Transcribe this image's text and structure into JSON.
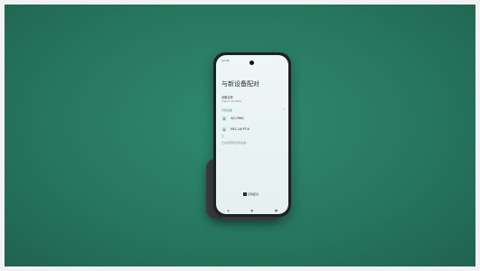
{
  "screen": {
    "title": "与新设备配对",
    "device_name_label": "设备名称",
    "device_name_value": "Xiaomi 14 Ultra",
    "available_label": "可用设备",
    "devices": [
      {
        "name": "XJQ-P86C"
      },
      {
        "name": "MEC-LW-PT-N"
      }
    ],
    "hint": "正在搜索附近的设备…",
    "pair_button_label": "扫码配对",
    "status_time": "12:05"
  }
}
